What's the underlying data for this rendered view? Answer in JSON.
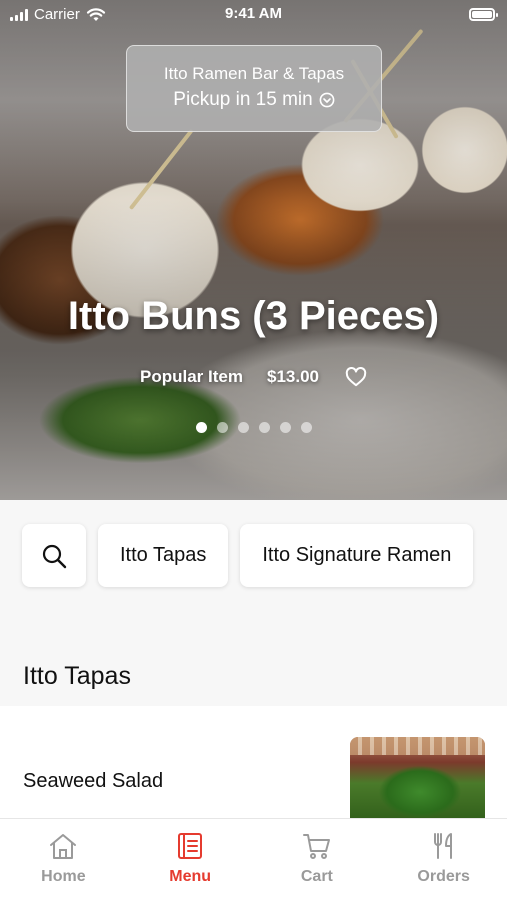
{
  "status_bar": {
    "carrier": "Carrier",
    "time": "9:41 AM",
    "battery_level": 1.0
  },
  "pickup": {
    "restaurant": "Itto Ramen Bar & Tapas",
    "pickup_text": "Pickup in 15 min"
  },
  "featured": {
    "title": "Itto Buns (3 Pieces)",
    "tag": "Popular Item",
    "price": "$13.00",
    "slide_count": 6,
    "active_slide": 1
  },
  "categories": [
    "Itto Tapas",
    "Itto Signature Ramen"
  ],
  "section": {
    "title": "Itto Tapas"
  },
  "items": [
    {
      "name": "Seaweed Salad"
    }
  ],
  "tabs": [
    {
      "label": "Home",
      "icon": "home-icon"
    },
    {
      "label": "Menu",
      "icon": "menu-icon",
      "active": true
    },
    {
      "label": "Cart",
      "icon": "cart-icon"
    },
    {
      "label": "Orders",
      "icon": "fork-knife-icon"
    }
  ],
  "colors": {
    "accent": "#e53b2f",
    "inactive_tab": "#9a9a9a"
  }
}
